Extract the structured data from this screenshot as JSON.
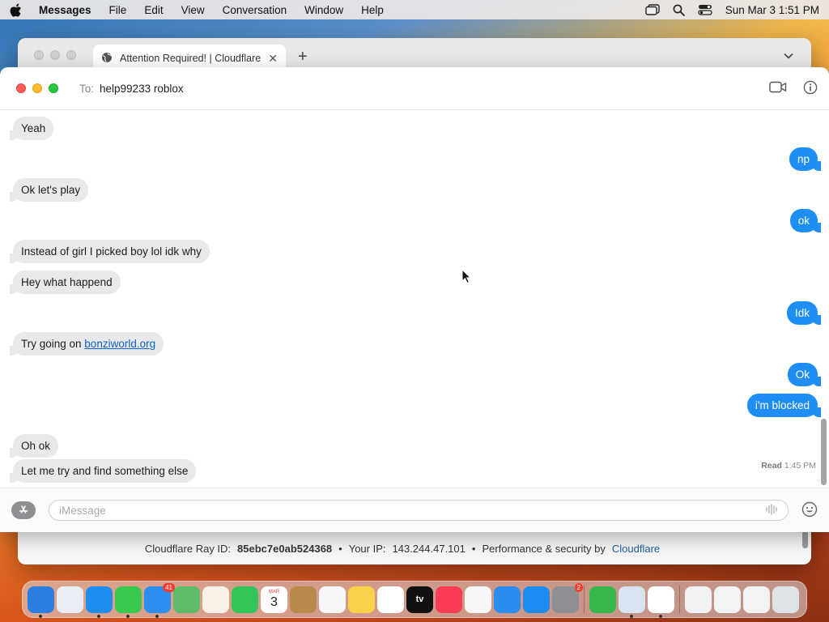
{
  "menubar": {
    "app_name": "Messages",
    "menus": [
      "File",
      "Edit",
      "View",
      "Conversation",
      "Window",
      "Help"
    ],
    "clock": "Sun Mar 3  1:51 PM",
    "status_icons": [
      "stage-manager-icon",
      "spotlight-search-icon",
      "control-center-icon"
    ]
  },
  "browser": {
    "tab_title": "Attention Required! | Cloudflare",
    "footer": {
      "ray_label": "Cloudflare Ray ID:",
      "ray_id": "85ebc7e0ab524368",
      "bullet": "•",
      "ip_label": "Your IP:",
      "ip": "143.244.47.101",
      "perf_label": "Performance & security by",
      "perf_link": "Cloudflare"
    }
  },
  "chat": {
    "to_label": "To:",
    "recipient": "help99233 roblox",
    "messages": [
      {
        "dir": "in",
        "text": "Yeah"
      },
      {
        "dir": "out",
        "text": "np"
      },
      {
        "dir": "in",
        "text": "Ok let's play"
      },
      {
        "dir": "out",
        "text": "ok"
      },
      {
        "dir": "in",
        "text": "Instead of girl I picked boy lol idk why"
      },
      {
        "dir": "in",
        "text": "Hey what happend"
      },
      {
        "dir": "out",
        "text": "Idk"
      },
      {
        "dir": "in",
        "text": "Try going on ",
        "link": "bonziworld.org"
      },
      {
        "dir": "out",
        "text": "Ok"
      },
      {
        "dir": "out",
        "text": "i'm blocked"
      },
      {
        "dir": "in",
        "text": "Oh ok"
      },
      {
        "dir": "in",
        "text": "Let me try and find something else"
      }
    ],
    "read_receipt": {
      "label": "Read",
      "time": "1:45 PM"
    },
    "composer_placeholder": "iMessage"
  },
  "dock": {
    "items": [
      {
        "name": "finder",
        "color": "#2b7de0",
        "running": true
      },
      {
        "name": "launchpad",
        "color": "#e9eef6",
        "running": false
      },
      {
        "name": "safari",
        "color": "#1f8cf0",
        "running": true
      },
      {
        "name": "messages",
        "color": "#3ac94f",
        "running": true
      },
      {
        "name": "mail",
        "color": "#2d8ef2",
        "running": true,
        "badge": "41"
      },
      {
        "name": "maps",
        "color": "#5dbb6a",
        "running": false
      },
      {
        "name": "photos",
        "color": "#f6f0e6",
        "running": false
      },
      {
        "name": "facetime",
        "color": "#33c55a",
        "running": false
      },
      {
        "name": "calendar",
        "color": "#ffffff",
        "running": false,
        "label": "3",
        "month": "MAR"
      },
      {
        "name": "contacts",
        "color": "#b58a4a",
        "running": false
      },
      {
        "name": "reminders",
        "color": "#f7f7f7",
        "running": false
      },
      {
        "name": "notes",
        "color": "#f8d34a",
        "running": false
      },
      {
        "name": "freeform",
        "color": "#ffffff",
        "running": false
      },
      {
        "name": "apple-tv",
        "color": "#111111",
        "running": false,
        "label": "tv"
      },
      {
        "name": "music",
        "color": "#fa3d55",
        "running": false
      },
      {
        "name": "news",
        "color": "#f7f7f7",
        "running": false
      },
      {
        "name": "keynote",
        "color": "#2b8df0",
        "running": false
      },
      {
        "name": "app-store",
        "color": "#1d8cf2",
        "running": false
      },
      {
        "name": "system-settings",
        "color": "#8e8e93",
        "running": false,
        "badge": "2"
      },
      {
        "name": "sep"
      },
      {
        "name": "find-my",
        "color": "#36b54a",
        "running": false
      },
      {
        "name": "preview",
        "color": "#d8e4f0",
        "running": true
      },
      {
        "name": "chrome",
        "color": "#ffffff",
        "running": true
      },
      {
        "name": "sep"
      },
      {
        "name": "document",
        "color": "#f2f2f2",
        "running": false
      },
      {
        "name": "screenshot-folder",
        "color": "#f3f3f3",
        "running": false
      },
      {
        "name": "screenshot-folder-2",
        "color": "#f3f3f3",
        "running": false
      },
      {
        "name": "trash",
        "color": "#dfe3e8",
        "running": false
      }
    ]
  }
}
